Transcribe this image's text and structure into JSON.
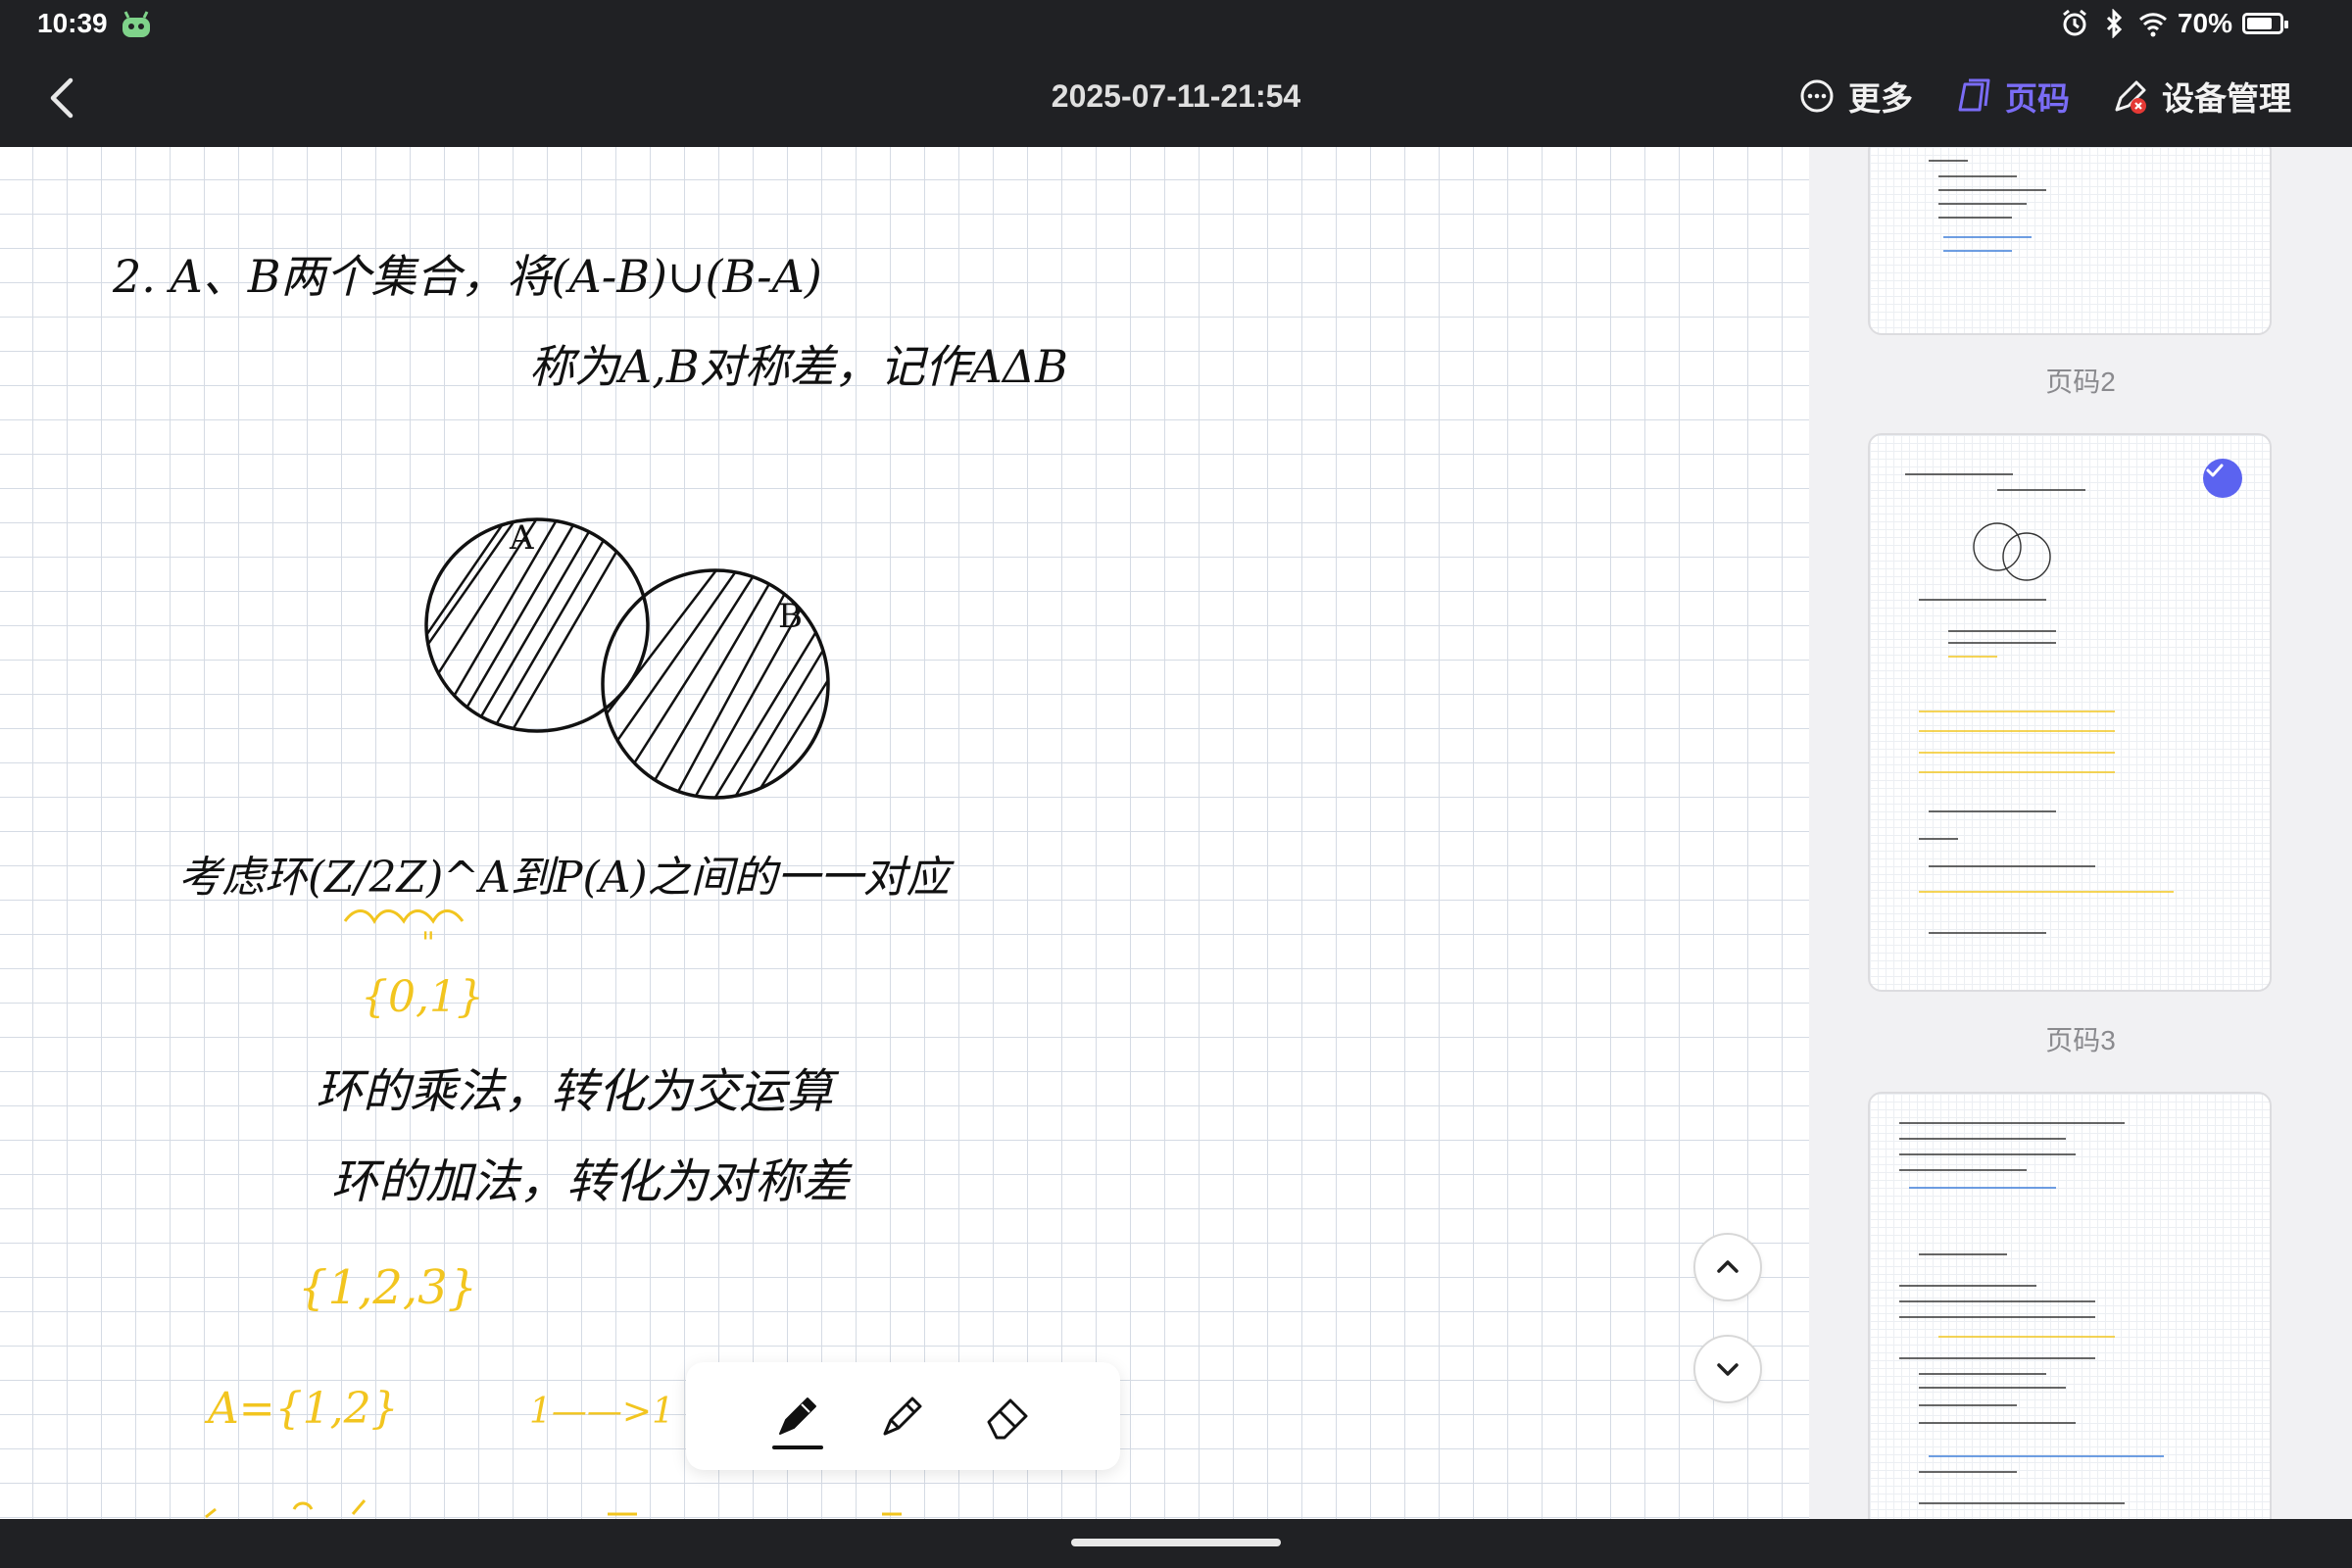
{
  "status_bar": {
    "time": "10:39",
    "battery": "70%",
    "battery_level": 0.7
  },
  "app_bar": {
    "title": "2025-07-11-21:54",
    "actions": {
      "more": "更多",
      "page_code": "页码",
      "device_management": "设备管理"
    }
  },
  "note": {
    "line1": "2. A、B两个集合，将(A-B)∪(B-A)",
    "line2": "称为A,B对称差，记作AΔB",
    "venn_a": "A",
    "venn_b": "B",
    "line3": "考虑环(Z/2Z)^A到P(A)之间的一一对应",
    "line3_under": "\"",
    "line4": "{0,1}",
    "line5": "环的乘法，转化为交运算",
    "line6": "环的加法，转化为对称差",
    "line7": "{1,2,3}",
    "line8": "A={1,2}",
    "line8_map": "1——>1"
  },
  "sidebar": {
    "pages": [
      {
        "label": "页码2",
        "selected": false
      },
      {
        "label": "页码3",
        "selected": true
      },
      {
        "label": "",
        "selected": false
      }
    ]
  },
  "colors": {
    "accent": "#7a6cf6",
    "check": "#5b63f0",
    "ink_black": "#111111",
    "ink_yellow": "#f2c51f",
    "ink_blue": "#3f7fd9",
    "bar_bg": "#202124"
  }
}
